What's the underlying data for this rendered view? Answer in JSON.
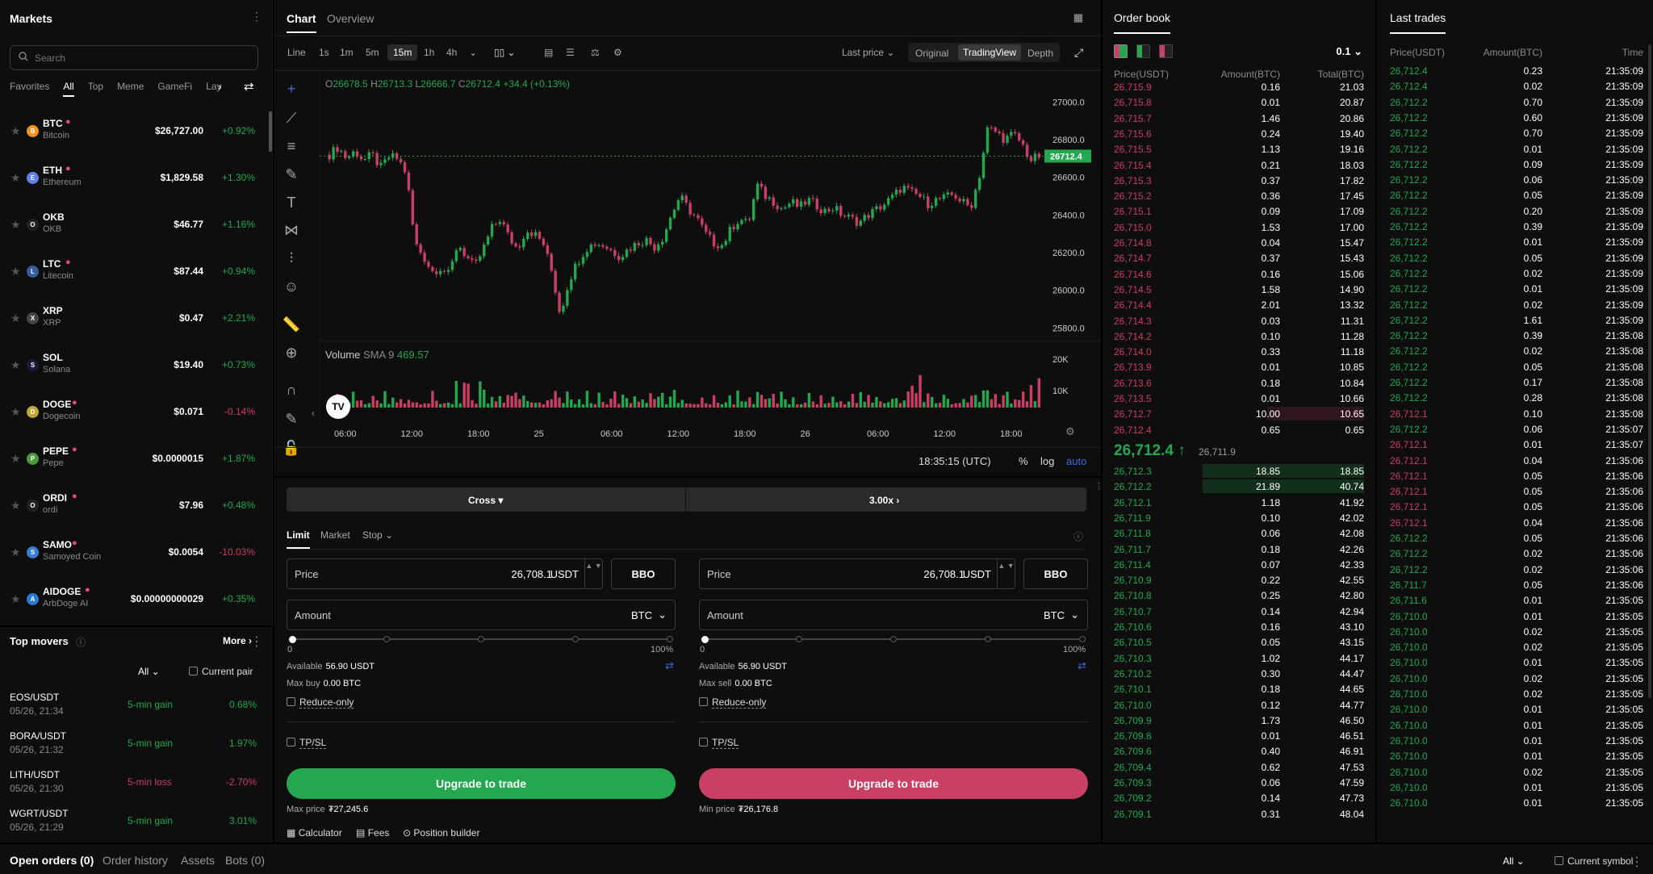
{
  "markets": {
    "title": "Markets",
    "search_placeholder": "Search",
    "tabs": [
      "Favorites",
      "All",
      "Top",
      "Meme",
      "GameFi",
      "Lay"
    ],
    "rows": [
      {
        "sym": "BTC",
        "name": "Bitcoin",
        "price": "$26,727.00",
        "chg": "+0.92%",
        "color": "#f7931a",
        "dir": "up",
        "hot": true
      },
      {
        "sym": "ETH",
        "name": "Ethereum",
        "price": "$1,829.58",
        "chg": "+1.30%",
        "color": "#627eea",
        "dir": "up",
        "hot": true
      },
      {
        "sym": "OKB",
        "name": "OKB",
        "price": "$46.77",
        "chg": "+1.16%",
        "color": "#222",
        "dir": "up",
        "hot": false
      },
      {
        "sym": "LTC",
        "name": "Litecoin",
        "price": "$87.44",
        "chg": "+0.94%",
        "color": "#345d9d",
        "dir": "up",
        "hot": true
      },
      {
        "sym": "XRP",
        "name": "XRP",
        "price": "$0.47",
        "chg": "+2.21%",
        "color": "#444",
        "dir": "up",
        "hot": false
      },
      {
        "sym": "SOL",
        "name": "Solana",
        "price": "$19.40",
        "chg": "+0.73%",
        "color": "#1a1a3a",
        "dir": "up",
        "hot": false
      },
      {
        "sym": "DOGE",
        "name": "Dogecoin",
        "price": "$0.071",
        "chg": "-0.14%",
        "color": "#c2a633",
        "dir": "down",
        "hot": true
      },
      {
        "sym": "PEPE",
        "name": "Pepe",
        "price": "$0.0000015",
        "chg": "+1.87%",
        "color": "#4c9a3a",
        "dir": "up",
        "hot": true
      },
      {
        "sym": "ORDI",
        "name": "ordi",
        "price": "$7.96",
        "chg": "+0.48%",
        "color": "#222",
        "dir": "up",
        "hot": true
      },
      {
        "sym": "SAMO",
        "name": "Samoyed Coin",
        "price": "$0.0054",
        "chg": "-10.03%",
        "color": "#3a7bd5",
        "dir": "down",
        "hot": true
      },
      {
        "sym": "AIDOGE",
        "name": "ArbDoge AI",
        "price": "$0.00000000029",
        "chg": "+0.35%",
        "color": "#2a7ad5",
        "dir": "up",
        "hot": true
      }
    ]
  },
  "movers": {
    "title": "Top movers",
    "more": "More",
    "filter": "All",
    "current_pair": "Current pair",
    "rows": [
      {
        "pair": "EOS/USDT",
        "time": "05/26, 21:34",
        "type": "5-min gain",
        "pct": "0.68%",
        "dir": "up"
      },
      {
        "pair": "BORA/USDT",
        "time": "05/26, 21:32",
        "type": "5-min gain",
        "pct": "1.97%",
        "dir": "up"
      },
      {
        "pair": "LITH/USDT",
        "time": "05/26, 21:30",
        "type": "5-min loss",
        "pct": "-2.70%",
        "dir": "down"
      },
      {
        "pair": "WGRT/USDT",
        "time": "05/26, 21:29",
        "type": "5-min gain",
        "pct": "3.01%",
        "dir": "up"
      }
    ]
  },
  "chart": {
    "tabs": [
      "Chart",
      "Overview"
    ],
    "intervals": [
      "Line",
      "1s",
      "1m",
      "5m",
      "15m",
      "1h",
      "4h"
    ],
    "active_interval": "15m",
    "price_type": "Last price",
    "views": [
      "Original",
      "TradingView",
      "Depth"
    ],
    "active_view": "TradingView",
    "ohlc": {
      "o_label": "O",
      "o": "26678.5",
      "h_label": "H",
      "h": "26713.3",
      "l_label": "L",
      "l": "26666.7",
      "c_label": "C",
      "c": "26712.4",
      "chg": "+34.4 (+0.13%)"
    },
    "last_price_tag": "26712.4",
    "y_ticks": [
      "27000.0",
      "26800.0",
      "26600.0",
      "26400.0",
      "26200.0",
      "26000.0",
      "25800.0"
    ],
    "x_ticks": [
      "06:00",
      "12:00",
      "18:00",
      "25",
      "06:00",
      "12:00",
      "18:00",
      "26",
      "06:00",
      "12:00",
      "18:00"
    ],
    "volume_label": "Volume",
    "sma_label": "SMA 9",
    "sma_value": "469.57",
    "vol_ticks": [
      "20K",
      "10K"
    ],
    "clock": "18:35:15 (UTC)",
    "scale_opts": [
      "%",
      "log",
      "auto"
    ]
  },
  "chart_data": {
    "type": "candlestick",
    "title": "",
    "xlabel": "",
    "ylabel": "",
    "ylim": [
      25750,
      27100
    ],
    "x_ticks": [
      "06:00",
      "12:00",
      "18:00",
      "25",
      "06:00",
      "12:00",
      "18:00",
      "26",
      "06:00",
      "12:00",
      "18:00"
    ],
    "last_price": 26712.4,
    "close_path": [
      26720,
      26760,
      26700,
      26740,
      26690,
      26720,
      26650,
      26710,
      26700,
      26620,
      26250,
      26180,
      26100,
      26120,
      26080,
      26250,
      26180,
      26120,
      26220,
      26330,
      26380,
      26280,
      26220,
      26320,
      26300,
      26250,
      26100,
      25870,
      26050,
      26150,
      26220,
      26250,
      26240,
      26210,
      26180,
      26220,
      26250,
      26270,
      26230,
      26280,
      26400,
      26500,
      26430,
      26380,
      26300,
      26250,
      26240,
      26330,
      26380,
      26350,
      26560,
      26500,
      26470,
      26430,
      26470,
      26440,
      26480,
      26450,
      26420,
      26440,
      26400,
      26380,
      26360,
      26400,
      26430,
      26460,
      26500,
      26550,
      26520,
      26500,
      26460,
      26480,
      26490,
      26510,
      26470,
      26440,
      26600,
      26860,
      26840,
      26800,
      26830,
      26780,
      26690,
      26712
    ]
  },
  "ctrl": {
    "mode": "Cross",
    "leverage": "3.00x",
    "order_types": [
      "Limit",
      "Market",
      "Stop"
    ]
  },
  "buy": {
    "price_label": "Price",
    "price": "26,708.1",
    "unit": "USDT",
    "bbo": "BBO",
    "amount_label": "Amount",
    "amount_unit": "BTC",
    "pct_min": "0",
    "pct_max": "100%",
    "available_label": "Available",
    "available": "56.90 USDT",
    "max_label": "Max buy",
    "max": "0.00 BTC",
    "reduce": "Reduce-only",
    "tpsl": "TP/SL",
    "cta": "Upgrade to trade",
    "limit_label": "Max price",
    "limit": "₮27,245.6"
  },
  "sell": {
    "price_label": "Price",
    "price": "26,708.1",
    "unit": "USDT",
    "bbo": "BBO",
    "amount_label": "Amount",
    "amount_unit": "BTC",
    "pct_min": "0",
    "pct_max": "100%",
    "available_label": "Available",
    "available": "56.90 USDT",
    "max_label": "Max sell",
    "max": "0.00 BTC",
    "reduce": "Reduce-only",
    "tpsl": "TP/SL",
    "cta": "Upgrade to trade",
    "limit_label": "Min price",
    "limit": "₮26,176.8"
  },
  "footer_tools": [
    "Calculator",
    "Fees",
    "Position builder"
  ],
  "orderbook": {
    "title": "Order book",
    "step": "0.1",
    "cols": [
      "Price(USDT)",
      "Amount(BTC)",
      "Total(BTC)"
    ],
    "mid_price": "26,712.4",
    "mid_arrow": "↑",
    "mid_ref": "26,711.9",
    "asks": [
      [
        "26,715.9",
        "0.16",
        "21.03"
      ],
      [
        "26,715.8",
        "0.01",
        "20.87"
      ],
      [
        "26,715.7",
        "1.46",
        "20.86"
      ],
      [
        "26,715.6",
        "0.24",
        "19.40"
      ],
      [
        "26,715.5",
        "1.13",
        "19.16"
      ],
      [
        "26,715.4",
        "0.21",
        "18.03"
      ],
      [
        "26,715.3",
        "0.37",
        "17.82"
      ],
      [
        "26,715.2",
        "0.36",
        "17.45"
      ],
      [
        "26,715.1",
        "0.09",
        "17.09"
      ],
      [
        "26,715.0",
        "1.53",
        "17.00"
      ],
      [
        "26,714.8",
        "0.04",
        "15.47"
      ],
      [
        "26,714.7",
        "0.37",
        "15.43"
      ],
      [
        "26,714.6",
        "0.16",
        "15.06"
      ],
      [
        "26,714.5",
        "1.58",
        "14.90"
      ],
      [
        "26,714.4",
        "2.01",
        "13.32"
      ],
      [
        "26,714.3",
        "0.03",
        "11.31"
      ],
      [
        "26,714.2",
        "0.10",
        "11.28"
      ],
      [
        "26,714.0",
        "0.33",
        "11.18"
      ],
      [
        "26,713.9",
        "0.01",
        "10.85"
      ],
      [
        "26,713.6",
        "0.18",
        "10.84"
      ],
      [
        "26,713.5",
        "0.01",
        "10.66"
      ],
      [
        "26,712.7",
        "10.00",
        "10.65"
      ],
      [
        "26,712.4",
        "0.65",
        "0.65"
      ]
    ],
    "bids": [
      [
        "26,712.3",
        "18.85",
        "18.85"
      ],
      [
        "26,712.2",
        "21.89",
        "40.74"
      ],
      [
        "26,712.1",
        "1.18",
        "41.92"
      ],
      [
        "26,711.9",
        "0.10",
        "42.02"
      ],
      [
        "26,711.8",
        "0.06",
        "42.08"
      ],
      [
        "26,711.7",
        "0.18",
        "42.26"
      ],
      [
        "26,711.4",
        "0.07",
        "42.33"
      ],
      [
        "26,710.9",
        "0.22",
        "42.55"
      ],
      [
        "26,710.8",
        "0.25",
        "42.80"
      ],
      [
        "26,710.7",
        "0.14",
        "42.94"
      ],
      [
        "26,710.6",
        "0.16",
        "43.10"
      ],
      [
        "26,710.5",
        "0.05",
        "43.15"
      ],
      [
        "26,710.3",
        "1.02",
        "44.17"
      ],
      [
        "26,710.2",
        "0.30",
        "44.47"
      ],
      [
        "26,710.1",
        "0.18",
        "44.65"
      ],
      [
        "26,710.0",
        "0.12",
        "44.77"
      ],
      [
        "26,709.9",
        "1.73",
        "46.50"
      ],
      [
        "26,709.8",
        "0.01",
        "46.51"
      ],
      [
        "26,709.6",
        "0.40",
        "46.91"
      ],
      [
        "26,709.4",
        "0.62",
        "47.53"
      ],
      [
        "26,709.3",
        "0.06",
        "47.59"
      ],
      [
        "26,709.2",
        "0.14",
        "47.73"
      ],
      [
        "26,709.1",
        "0.31",
        "48.04"
      ]
    ]
  },
  "trades": {
    "title": "Last trades",
    "cols": [
      "Price(USDT)",
      "Amount(BTC)",
      "Time"
    ],
    "rows": [
      [
        "26,712.4",
        "0.23",
        "21:35:09",
        "up"
      ],
      [
        "26,712.4",
        "0.02",
        "21:35:09",
        "up"
      ],
      [
        "26,712.2",
        "0.70",
        "21:35:09",
        "up"
      ],
      [
        "26,712.2",
        "0.60",
        "21:35:09",
        "up"
      ],
      [
        "26,712.2",
        "0.70",
        "21:35:09",
        "up"
      ],
      [
        "26,712.2",
        "0.01",
        "21:35:09",
        "up"
      ],
      [
        "26,712.2",
        "0.09",
        "21:35:09",
        "up"
      ],
      [
        "26,712.2",
        "0.06",
        "21:35:09",
        "up"
      ],
      [
        "26,712.2",
        "0.05",
        "21:35:09",
        "up"
      ],
      [
        "26,712.2",
        "0.20",
        "21:35:09",
        "up"
      ],
      [
        "26,712.2",
        "0.39",
        "21:35:09",
        "up"
      ],
      [
        "26,712.2",
        "0.01",
        "21:35:09",
        "up"
      ],
      [
        "26,712.2",
        "0.05",
        "21:35:09",
        "up"
      ],
      [
        "26,712.2",
        "0.02",
        "21:35:09",
        "up"
      ],
      [
        "26,712.2",
        "0.01",
        "21:35:09",
        "up"
      ],
      [
        "26,712.2",
        "0.02",
        "21:35:09",
        "up"
      ],
      [
        "26,712.2",
        "1.61",
        "21:35:09",
        "up"
      ],
      [
        "26,712.2",
        "0.39",
        "21:35:08",
        "up"
      ],
      [
        "26,712.2",
        "0.02",
        "21:35:08",
        "up"
      ],
      [
        "26,712.2",
        "0.05",
        "21:35:08",
        "up"
      ],
      [
        "26,712.2",
        "0.17",
        "21:35:08",
        "up"
      ],
      [
        "26,712.2",
        "0.28",
        "21:35:08",
        "up"
      ],
      [
        "26,712.1",
        "0.10",
        "21:35:08",
        "down"
      ],
      [
        "26,712.2",
        "0.06",
        "21:35:07",
        "up"
      ],
      [
        "26,712.1",
        "0.01",
        "21:35:07",
        "down"
      ],
      [
        "26,712.1",
        "0.04",
        "21:35:06",
        "down"
      ],
      [
        "26,712.1",
        "0.05",
        "21:35:06",
        "down"
      ],
      [
        "26,712.1",
        "0.05",
        "21:35:06",
        "down"
      ],
      [
        "26,712.1",
        "0.05",
        "21:35:06",
        "down"
      ],
      [
        "26,712.1",
        "0.04",
        "21:35:06",
        "down"
      ],
      [
        "26,712.2",
        "0.05",
        "21:35:06",
        "up"
      ],
      [
        "26,712.2",
        "0.02",
        "21:35:06",
        "up"
      ],
      [
        "26,712.2",
        "0.02",
        "21:35:06",
        "up"
      ],
      [
        "26,711.7",
        "0.05",
        "21:35:06",
        "up"
      ],
      [
        "26,711.6",
        "0.01",
        "21:35:05",
        "up"
      ],
      [
        "26,710.0",
        "0.01",
        "21:35:05",
        "up"
      ],
      [
        "26,710.0",
        "0.02",
        "21:35:05",
        "up"
      ],
      [
        "26,710.0",
        "0.02",
        "21:35:05",
        "up"
      ],
      [
        "26,710.0",
        "0.01",
        "21:35:05",
        "up"
      ],
      [
        "26,710.0",
        "0.02",
        "21:35:05",
        "up"
      ],
      [
        "26,710.0",
        "0.02",
        "21:35:05",
        "up"
      ],
      [
        "26,710.0",
        "0.01",
        "21:35:05",
        "up"
      ],
      [
        "26,710.0",
        "0.01",
        "21:35:05",
        "up"
      ],
      [
        "26,710.0",
        "0.01",
        "21:35:05",
        "up"
      ],
      [
        "26,710.0",
        "0.01",
        "21:35:05",
        "up"
      ],
      [
        "26,710.0",
        "0.02",
        "21:35:05",
        "up"
      ],
      [
        "26,710.0",
        "0.01",
        "21:35:05",
        "up"
      ],
      [
        "26,710.0",
        "0.01",
        "21:35:05",
        "up"
      ]
    ]
  },
  "bottom": {
    "tabs": [
      "Open orders (0)",
      "Order history",
      "Assets",
      "Bots (0)"
    ],
    "filter": "All",
    "current_symbol": "Current symbol"
  },
  "colors": {
    "up": "#25a750",
    "down": "#ca3f64",
    "bg": "#0e0e0e"
  }
}
